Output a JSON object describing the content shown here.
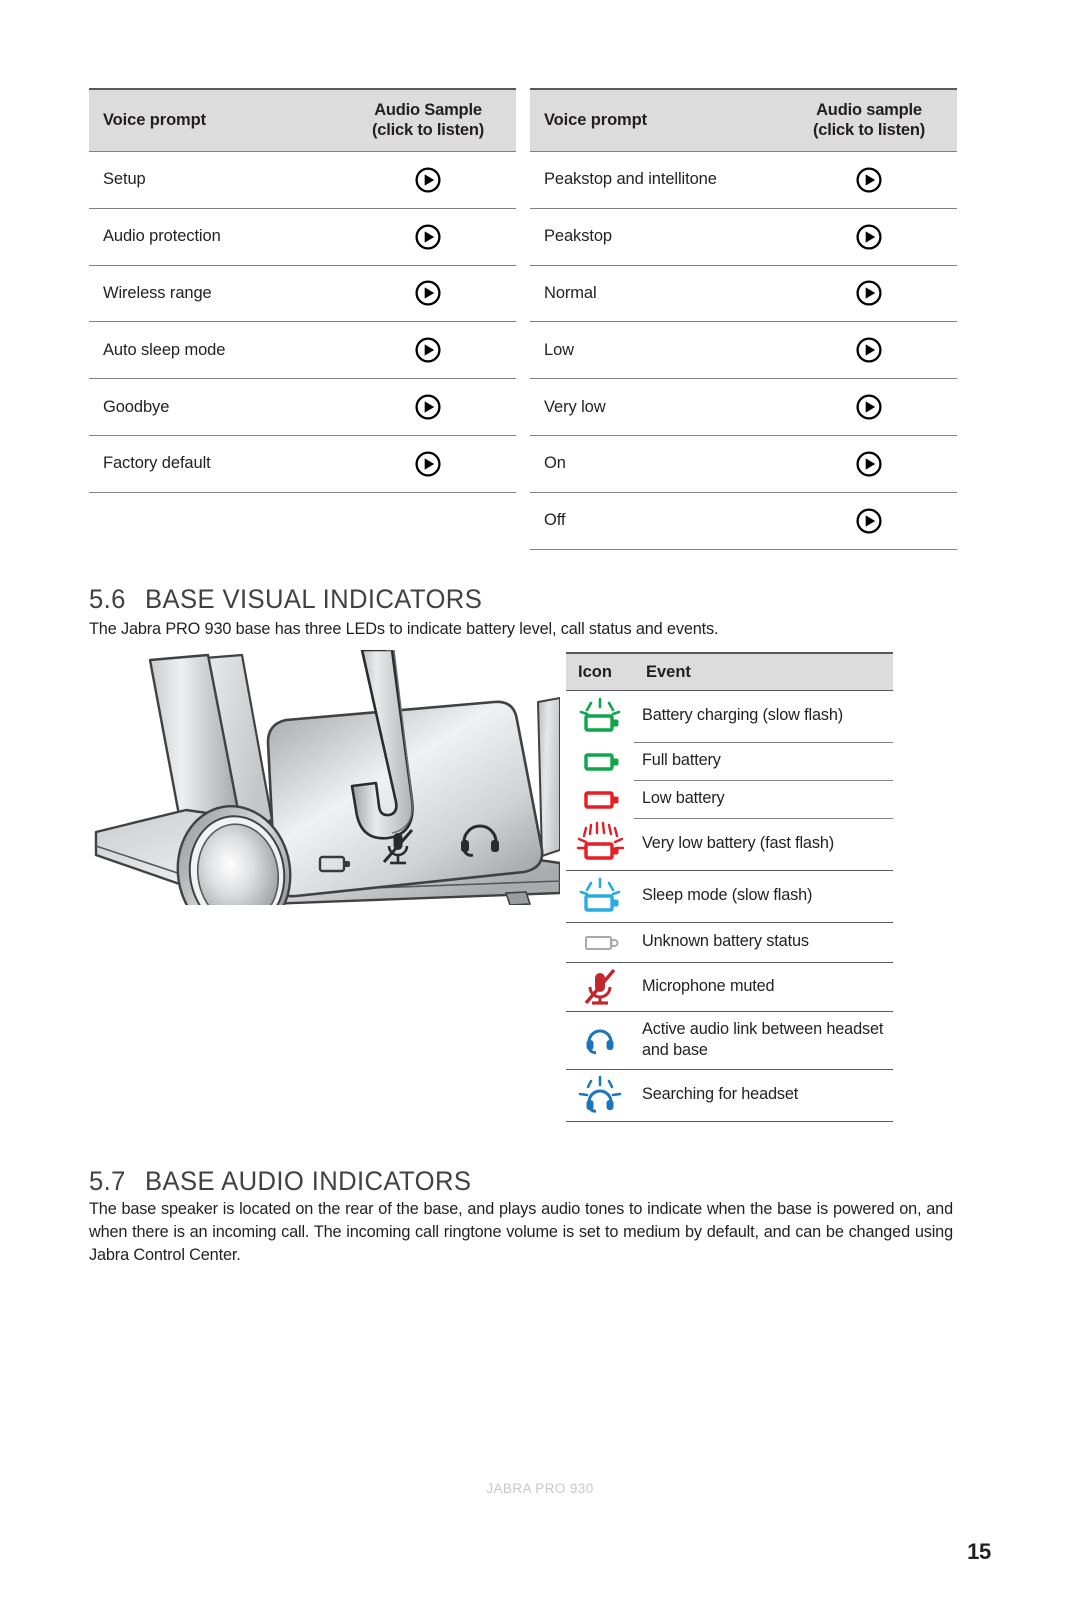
{
  "voice_prompt_tables": [
    {
      "headers": {
        "prompt": "Voice prompt",
        "sample_line1": "Audio Sample",
        "sample_line2": "(click to listen)"
      },
      "rows": [
        {
          "label": "Setup",
          "icon": "play-icon"
        },
        {
          "label": "Audio protection",
          "icon": "play-icon"
        },
        {
          "label": "Wireless range",
          "icon": "play-icon"
        },
        {
          "label": "Auto sleep mode",
          "icon": "play-icon"
        },
        {
          "label": "Goodbye",
          "icon": "play-icon"
        },
        {
          "label": "Factory default",
          "icon": "play-icon"
        }
      ]
    },
    {
      "headers": {
        "prompt": "Voice prompt",
        "sample_line1": "Audio sample",
        "sample_line2": "(click to listen)"
      },
      "rows": [
        {
          "label": "Peakstop and intellitone",
          "icon": "play-icon"
        },
        {
          "label": "Peakstop",
          "icon": "play-icon"
        },
        {
          "label": "Normal",
          "icon": "play-icon"
        },
        {
          "label": "Low",
          "icon": "play-icon"
        },
        {
          "label": "Very low",
          "icon": "play-icon"
        },
        {
          "label": "On",
          "icon": "play-icon"
        },
        {
          "label": "Off",
          "icon": "play-icon"
        }
      ]
    }
  ],
  "section_visual": {
    "number": "5.6",
    "title": "BASE VISUAL INDICATORS",
    "intro": "The Jabra PRO 930 base has three LEDs to indicate battery level, call status and events."
  },
  "base_illustration": {
    "alt": "Jabra PRO 930 base unit with headset docked",
    "panel_icons": [
      "battery-icon",
      "microphone-muted-icon",
      "headset-icon"
    ]
  },
  "icon_event_table": {
    "headers": {
      "icon": "Icon",
      "event": "Event"
    },
    "rows": [
      {
        "icon": "battery-charging-icon",
        "event": "Battery charging (slow flash)"
      },
      {
        "icon": "battery-full-icon",
        "event": "Full battery"
      },
      {
        "icon": "battery-low-icon",
        "event": "Low battery"
      },
      {
        "icon": "battery-very-low-flashing-icon",
        "event": "Very low battery (fast flash)"
      },
      {
        "icon": "battery-sleep-flashing-icon",
        "event": "Sleep mode (slow flash)"
      },
      {
        "icon": "battery-unknown-icon",
        "event": "Unknown battery status"
      },
      {
        "icon": "microphone-muted-icon",
        "event": "Microphone muted"
      },
      {
        "icon": "headset-link-icon",
        "event": "Active audio link between headset and base"
      },
      {
        "icon": "headset-searching-icon",
        "event": "Searching for headset"
      }
    ]
  },
  "section_audio": {
    "number": "5.7",
    "title": "BASE AUDIO INDICATORS",
    "body": "The base speaker is located on the rear of the base, and plays audio tones to indicate when the base is powered on, and when there is an incoming call. The incoming call ringtone volume is set to medium by default, and can be changed using Jabra Control Center."
  },
  "footer": {
    "brand": "JABRA PRO 930",
    "page_number": "15"
  },
  "colors": {
    "green": "#0fa54a",
    "red": "#e31e24",
    "blue": "#29abe2",
    "gray_icon": "#a7a9ac",
    "header_bg": "#dcdcdc",
    "rule_dark": "#58595b",
    "rule_light": "#808285",
    "text": "#231f20",
    "heading": "#414042",
    "footer_brand": "#c7c8ca"
  }
}
